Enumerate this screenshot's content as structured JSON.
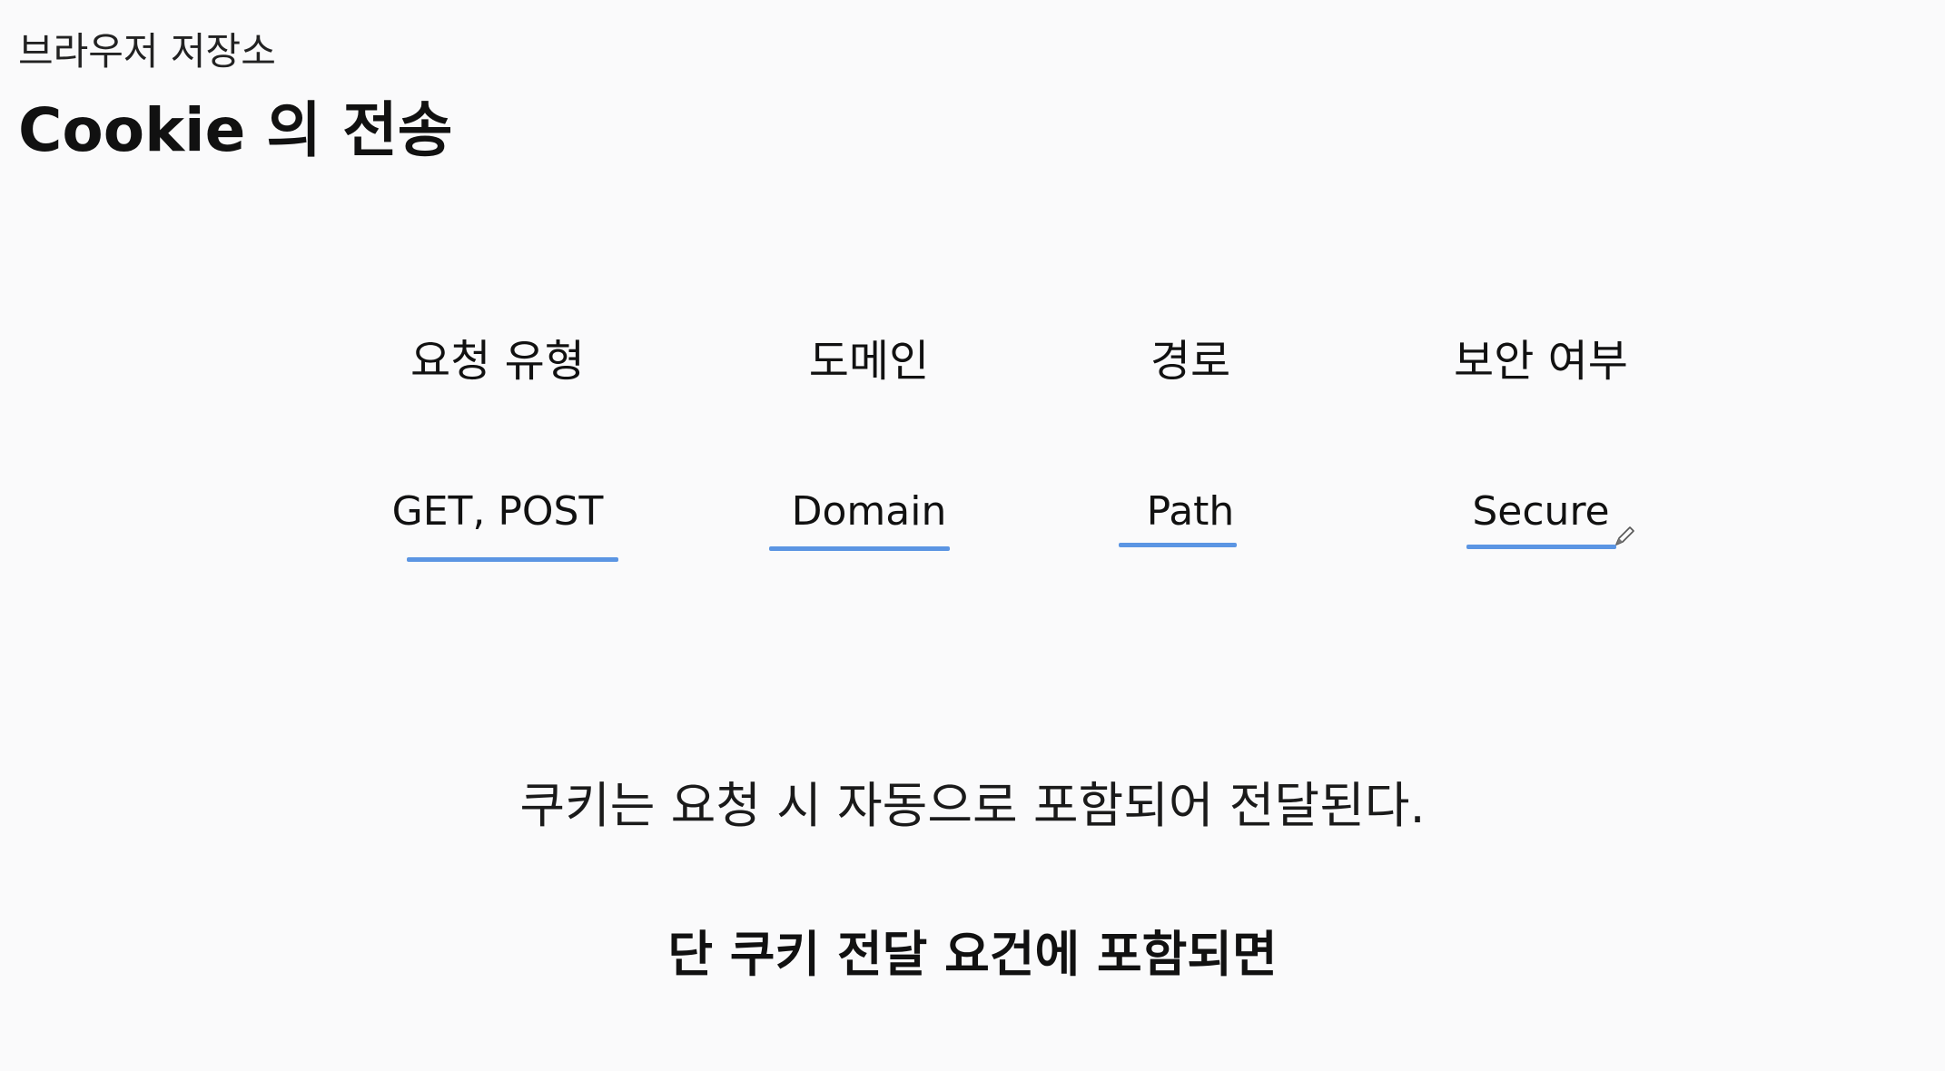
{
  "header": {
    "subtitle": "브라우저 저장소",
    "title": "Cookie 의 전송"
  },
  "columns": [
    {
      "heading": "요청 유형",
      "value": "GET, POST"
    },
    {
      "heading": "도메인",
      "value": "Domain"
    },
    {
      "heading": "경로",
      "value": "Path"
    },
    {
      "heading": "보안 여부",
      "value": "Secure"
    }
  ],
  "body": {
    "line1": "쿠키는 요청 시 자동으로 포함되어 전달된다.",
    "line2": "단 쿠키 전달 요건에 포함되면"
  },
  "colors": {
    "accent_underline": "#5b95e3",
    "background": "#fafafb"
  },
  "icons": {
    "annotation_tool": "pen-icon"
  }
}
